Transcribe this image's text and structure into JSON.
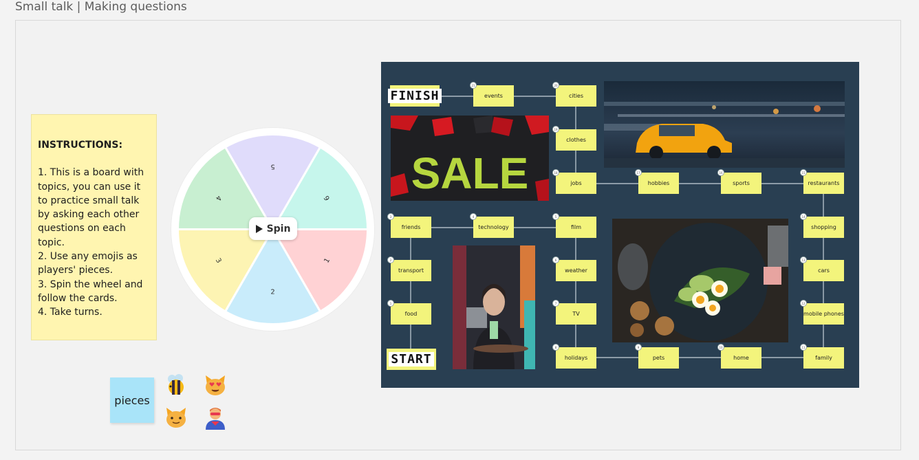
{
  "page": {
    "title": "Small talk | Making questions"
  },
  "instructions": {
    "title": "INSTRUCTIONS:",
    "lines": [
      "1. This is a board with topics, you can use it to practice small talk by asking each other questions on each topic.",
      "2. Use any emojis as players' pieces.",
      "3. Spin the wheel and follow the cards.",
      "4. Take turns."
    ]
  },
  "wheel": {
    "spin_label": "Spin",
    "segments": [
      {
        "label": "5",
        "color": "#e0dcfb"
      },
      {
        "label": "6",
        "color": "#c6f6ec"
      },
      {
        "label": "1",
        "color": "#ffd2d4"
      },
      {
        "label": "2",
        "color": "#c9ecfb"
      },
      {
        "label": "3",
        "color": "#fdf4b3"
      },
      {
        "label": "4",
        "color": "#c8efd1"
      }
    ]
  },
  "pieces": {
    "label": "pieces",
    "emojis": [
      "bee-emoji",
      "heart-eyes-cat-emoji",
      "cat-face-emoji",
      "superhero-emoji"
    ]
  },
  "board": {
    "start_label": "START",
    "finish_label": "FINISH",
    "colors": {
      "background": "#293f52",
      "card": "#f3f47c"
    },
    "cards": [
      {
        "n": "1",
        "label": "food"
      },
      {
        "n": "2",
        "label": "transport"
      },
      {
        "n": "3",
        "label": "friends"
      },
      {
        "n": "4",
        "label": "technology"
      },
      {
        "n": "5",
        "label": "film"
      },
      {
        "n": "6",
        "label": "weather"
      },
      {
        "n": "7",
        "label": "TV"
      },
      {
        "n": "8",
        "label": "holidays"
      },
      {
        "n": "9",
        "label": "pets"
      },
      {
        "n": "10",
        "label": "home"
      },
      {
        "n": "11",
        "label": "family"
      },
      {
        "n": "12",
        "label": "mobile phones"
      },
      {
        "n": "13",
        "label": "cars"
      },
      {
        "n": "14",
        "label": "shopping"
      },
      {
        "n": "15",
        "label": "restaurants"
      },
      {
        "n": "16",
        "label": "sports"
      },
      {
        "n": "17",
        "label": "hobbies"
      },
      {
        "n": "18",
        "label": "jobs"
      },
      {
        "n": "19",
        "label": "clothes"
      },
      {
        "n": "20",
        "label": "cities"
      },
      {
        "n": "21",
        "label": "events"
      }
    ],
    "photos": {
      "sale_text": "SALE",
      "sale": "sale-sign-photo",
      "taxi": "taxi-street-photo",
      "cafe": "person-drinking-cafe-photo",
      "food": "avocado-egg-toast-photo"
    }
  }
}
